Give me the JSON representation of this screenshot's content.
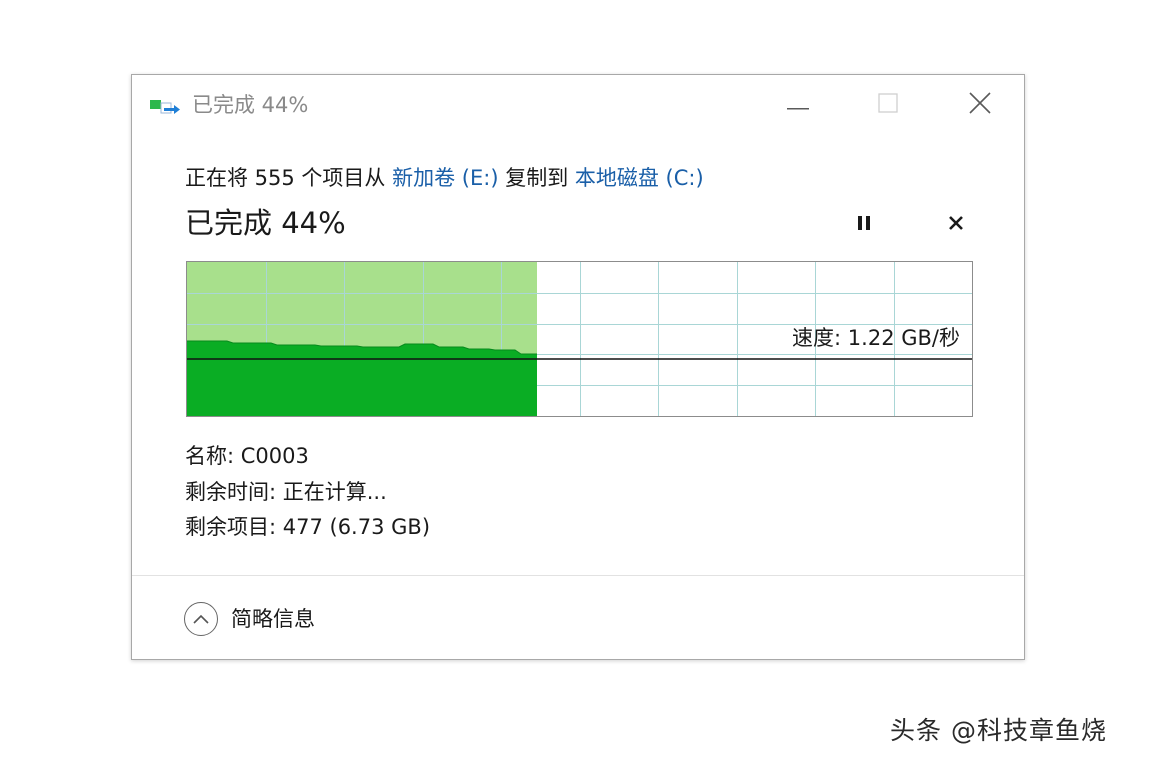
{
  "window": {
    "title": "已完成 44%",
    "icon": "copy-transfer-icon"
  },
  "window_controls": {
    "minimize_icon": "minimize-icon",
    "maximize_icon": "maximize-icon",
    "close_icon": "close-icon"
  },
  "description": {
    "prefix": "正在将 555 个项目从 ",
    "source": "新加卷 (E:)",
    "middle": " 复制到 ",
    "destination": "本地磁盘 (C:)"
  },
  "progress": {
    "title": "已完成 44%",
    "percent": 44,
    "pause_icon": "pause-icon",
    "cancel_icon": "cancel-icon"
  },
  "speed": {
    "label": "速度: 1.22 GB/秒"
  },
  "details": {
    "name": "名称: C0003",
    "time_remaining": "剩余时间: 正在计算...",
    "items_remaining": "剩余项目: 477 (6.73 GB)"
  },
  "footer": {
    "toggle_label": "简略信息",
    "toggle_icon": "chevron-up-icon"
  },
  "watermark": "头条 @科技章鱼烧",
  "colors": {
    "fill_light": "#a8e08c",
    "fill_dark": "#0aad24",
    "grid": "#a9d6d6",
    "link": "#1a5fa8"
  }
}
